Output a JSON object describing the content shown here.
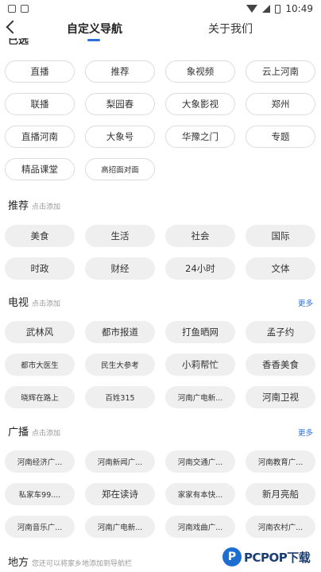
{
  "status": {
    "time": "10:49"
  },
  "header": {
    "tab_custom": "自定义导航",
    "tab_about": "关于我们",
    "partial_title": "已选"
  },
  "selected": {
    "items": [
      "直播",
      "推荐",
      "象视频",
      "云上河南",
      "联播",
      "梨园春",
      "大象影视",
      "郑州",
      "直播河南",
      "大象号",
      "华豫之门",
      "专题",
      "精品课堂",
      "高招面对面"
    ]
  },
  "recommend": {
    "title": "推荐",
    "hint": "点击添加",
    "items": [
      "美食",
      "生活",
      "社会",
      "国际",
      "时政",
      "财经",
      "24小时",
      "文体"
    ]
  },
  "tv": {
    "title": "电视",
    "hint": "点击添加",
    "more": "更多",
    "items": [
      "武林风",
      "都市报道",
      "打鱼晒网",
      "孟子约",
      "都市大医生",
      "民生大参考",
      "小莉帮忙",
      "香香美食",
      "晓辉在路上",
      "百姓315",
      "河南广电新...",
      "河南卫视"
    ]
  },
  "radio": {
    "title": "广播",
    "hint": "点击添加",
    "more": "更多",
    "items": [
      "河南经济广...",
      "河南新闻广...",
      "河南交通广...",
      "河南教育广...",
      "私家车99....",
      "郑在读诗",
      "家家有本快...",
      "新月亮船",
      "河南音乐广...",
      "河南广电新...",
      "河南戏曲广...",
      "河南农村广..."
    ]
  },
  "local": {
    "title": "地方",
    "hint": "您还可以将家乡地添加到导航栏"
  },
  "brand": {
    "logo_letter": "P",
    "name": "PCPOP下载"
  }
}
